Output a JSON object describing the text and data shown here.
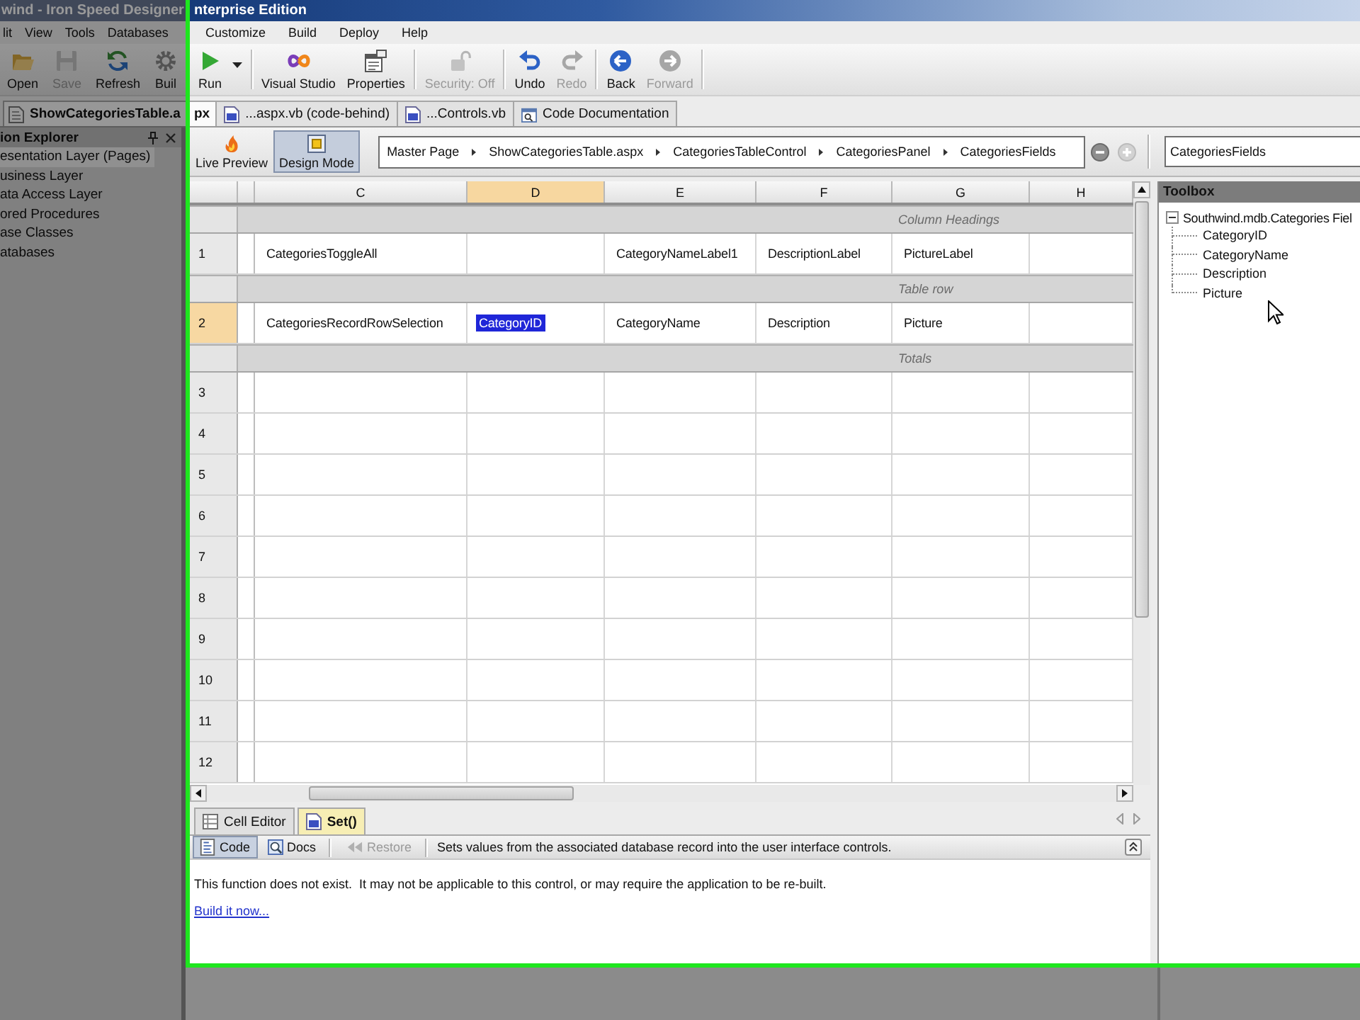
{
  "window": {
    "title_dimmed": "wind - Iron Speed Designer",
    "title": "nterprise Edition"
  },
  "menu": [
    {
      "label": "lit",
      "dimmed": true
    },
    {
      "label": "View",
      "dimmed": true
    },
    {
      "label": "Tools",
      "dimmed": true
    },
    {
      "label": "Databases",
      "dimmed": true
    },
    {
      "label": "Customize",
      "dimmed": false
    },
    {
      "label": "Build",
      "dimmed": false
    },
    {
      "label": "Deploy",
      "dimmed": false
    },
    {
      "label": "Help",
      "dimmed": false
    }
  ],
  "toolbar": [
    {
      "dimmed": true,
      "items": [
        {
          "label": "Open",
          "disabled": false,
          "dropdown": false
        },
        {
          "label": "Save",
          "disabled": true,
          "dropdown": false
        },
        {
          "label": "Refresh",
          "disabled": false,
          "dropdown": false
        },
        {
          "label": "Buil",
          "disabled": false,
          "dropdown": false
        }
      ]
    },
    {
      "dimmed": false,
      "items": [
        {
          "label": "Run",
          "disabled": false,
          "dropdown": true
        }
      ]
    },
    {
      "dimmed": false,
      "items": [
        {
          "label": "Visual Studio",
          "disabled": false,
          "dropdown": false
        },
        {
          "label": "Properties",
          "disabled": false,
          "dropdown": false
        }
      ]
    },
    {
      "dimmed": false,
      "items": [
        {
          "label": "Security: Off",
          "disabled": true,
          "dropdown": false
        }
      ]
    },
    {
      "dimmed": false,
      "items": [
        {
          "label": "Undo",
          "disabled": false,
          "dropdown": false
        },
        {
          "label": "Redo",
          "disabled": true,
          "dropdown": false
        }
      ]
    },
    {
      "dimmed": false,
      "items": [
        {
          "label": "Back",
          "disabled": false,
          "dropdown": false
        },
        {
          "label": "Forward",
          "disabled": true,
          "dropdown": false
        }
      ]
    }
  ],
  "document_tabs": [
    {
      "label_dimmed": "ShowCategoriesTable.a",
      "label": "px",
      "selected": true
    },
    {
      "label": "...aspx.vb (code-behind)",
      "selected": false
    },
    {
      "label": "...Controls.vb",
      "selected": false
    },
    {
      "label": "Code Documentation",
      "selected": false
    }
  ],
  "solution_explorer": {
    "title": "ion Explorer",
    "items": [
      {
        "label": "esentation Layer (Pages)",
        "selected": true
      },
      {
        "label": "usiness Layer",
        "selected": false
      },
      {
        "label": "ata Access Layer",
        "selected": false
      },
      {
        "label": "ored Procedures",
        "selected": false
      },
      {
        "label": "ase Classes",
        "selected": false
      },
      {
        "label": "atabases",
        "selected": false
      }
    ]
  },
  "designer": {
    "view_modes": [
      {
        "label": "Live Preview",
        "selected": false
      },
      {
        "label": "Design Mode",
        "selected": true
      }
    ],
    "breadcrumb": [
      "Master Page",
      "ShowCategoriesTable.aspx",
      "CategoriesTableControl",
      "CategoriesPanel",
      "CategoriesFields"
    ],
    "zoom_out": {
      "disabled": false
    },
    "zoom_in": {
      "disabled": true
    },
    "control_field": {
      "value": "CategoriesFields"
    }
  },
  "grid": {
    "columns": [
      {
        "label": "C",
        "selected": false
      },
      {
        "label": "D",
        "selected": true
      },
      {
        "label": "E",
        "selected": false
      },
      {
        "label": "F",
        "selected": false
      },
      {
        "label": "G",
        "selected": false
      },
      {
        "label": "H",
        "selected": false
      }
    ],
    "rows": [
      {
        "kind": "section",
        "label": "Column Headings"
      },
      {
        "kind": "row",
        "number": "1",
        "selected": false,
        "cells": [
          {
            "text": "CategoriesToggleAll",
            "selected": false
          },
          {
            "selected": false
          },
          {
            "text": "CategoryNameLabel1",
            "selected": false
          },
          {
            "text": "DescriptionLabel",
            "selected": false
          },
          {
            "text": "PictureLabel",
            "selected": false
          },
          {
            "selected": false
          }
        ]
      },
      {
        "kind": "section",
        "label": "Table row"
      },
      {
        "kind": "row",
        "number": "2",
        "selected": true,
        "cells": [
          {
            "text": "CategoriesRecordRowSelection",
            "selected": false
          },
          {
            "text": "CategoryID",
            "selected": true
          },
          {
            "text": "CategoryName",
            "selected": false
          },
          {
            "text": "Description",
            "selected": false
          },
          {
            "text": "Picture",
            "selected": false
          },
          {
            "selected": false
          }
        ]
      },
      {
        "kind": "section",
        "label": "Totals"
      },
      {
        "kind": "row",
        "number": "3",
        "selected": false
      },
      {
        "kind": "row",
        "number": "4",
        "selected": false
      },
      {
        "kind": "row",
        "number": "5",
        "selected": false
      },
      {
        "kind": "row",
        "number": "6",
        "selected": false
      },
      {
        "kind": "row",
        "number": "7",
        "selected": false
      },
      {
        "kind": "row",
        "number": "8",
        "selected": false
      },
      {
        "kind": "row",
        "number": "9",
        "selected": false
      },
      {
        "kind": "row",
        "number": "10",
        "selected": false
      },
      {
        "kind": "row",
        "number": "11",
        "selected": false
      },
      {
        "kind": "row",
        "number": "12",
        "selected": false
      }
    ]
  },
  "toolbox": {
    "title": "Toolbox",
    "tree": [
      {
        "label": "Southwind.mdb.Categories Fiel",
        "expanded": true,
        "children": [
          {
            "label": "CategoryID"
          },
          {
            "label": "CategoryName"
          },
          {
            "label": "Description"
          },
          {
            "label": "Picture"
          }
        ]
      }
    ]
  },
  "bottom_panel": {
    "tabs": [
      {
        "label": "Cell Editor",
        "selected": false
      },
      {
        "label": "Set()",
        "selected": true
      }
    ],
    "toolbar": [
      {
        "label": "Code",
        "selected": true,
        "disabled": false
      },
      {
        "label": "Docs",
        "selected": false,
        "disabled": false
      },
      {
        "label": "Restore",
        "selected": false,
        "disabled": true
      }
    ],
    "description": "Sets values from the associated database record into the user interface controls.",
    "message": "This function does not exist.  It may not be applicable to this control, or may require the application to be re-built.",
    "link": "Build it now..."
  }
}
